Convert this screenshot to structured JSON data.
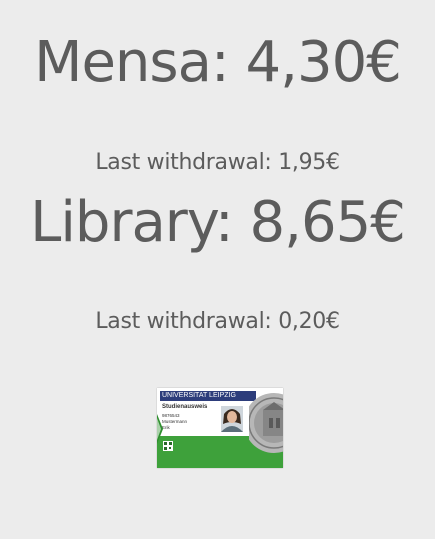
{
  "mensa": {
    "balance": "Mensa: 4,30€",
    "last_withdrawal": "Last withdrawal: 1,95€"
  },
  "library": {
    "balance": "Library: 8,65€",
    "last_withdrawal": "Last withdrawal: 0,20€"
  },
  "card": {
    "university": "UNIVERSITAT LEIPZIG",
    "title": "Studienausweis",
    "number": "9876543",
    "surname": "Mustermann",
    "given_name": "Erik",
    "icon": "student-id-card-icon",
    "colors": {
      "header": "#2d3d7b",
      "band": "#3ea13b"
    }
  },
  "colors": {
    "background": "#ececec",
    "text": "#5c5c5c"
  }
}
